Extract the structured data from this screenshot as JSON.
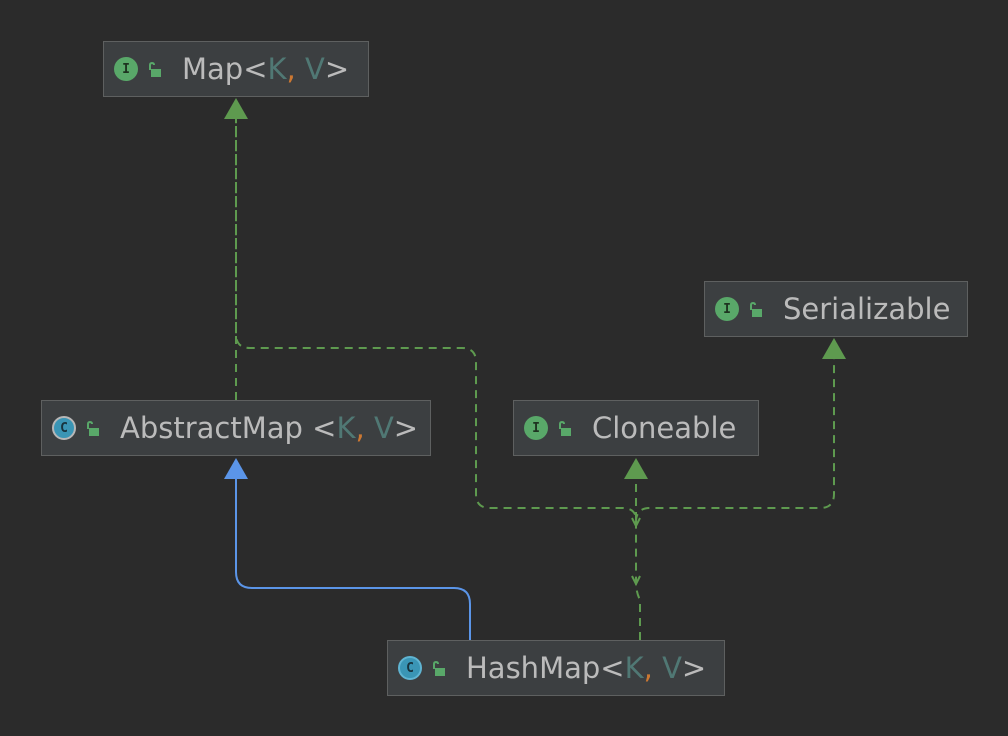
{
  "colors": {
    "background": "#2b2b2b",
    "node_fill": "#3c3f41",
    "node_border": "#5e6060",
    "text": "#bbbbbb",
    "type_param": "#507874",
    "comma": "#cc7832",
    "implements_edge": "#5e9a4f",
    "extends_edge": "#5b95e8"
  },
  "nodes": {
    "map": {
      "kind_icon": "interface-icon",
      "kind_letter": "I",
      "name": "Map",
      "lt": "<",
      "p1": "K",
      "comma": ",",
      "p2": "V",
      "gt": ">"
    },
    "serializable": {
      "kind_icon": "interface-icon",
      "kind_letter": "I",
      "name": "Serializable"
    },
    "abstract_map": {
      "kind_icon": "abstract-class-icon",
      "kind_letter": "C",
      "name": "AbstractMap",
      "lt": "<",
      "p1": "K",
      "comma": ",",
      "p2": "V",
      "gt": ">"
    },
    "cloneable": {
      "kind_icon": "interface-icon",
      "kind_letter": "I",
      "name": "Cloneable"
    },
    "hash_map": {
      "kind_icon": "class-icon",
      "kind_letter": "C",
      "name": "HashMap",
      "lt": "<",
      "p1": "K",
      "comma": ",",
      "p2": "V",
      "gt": ">"
    }
  },
  "edges": [
    {
      "from": "AbstractMap",
      "to": "Map",
      "relation": "implements"
    },
    {
      "from": "HashMap",
      "to": "Map",
      "relation": "implements"
    },
    {
      "from": "HashMap",
      "to": "Cloneable",
      "relation": "implements"
    },
    {
      "from": "HashMap",
      "to": "Serializable",
      "relation": "implements"
    },
    {
      "from": "HashMap",
      "to": "AbstractMap",
      "relation": "extends"
    }
  ]
}
